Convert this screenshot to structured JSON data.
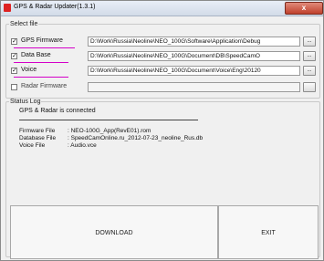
{
  "window": {
    "title": "GPS & Radar Updater(1.3.1)",
    "close_glyph": "x"
  },
  "select_file": {
    "legend": "Select file",
    "rows": [
      {
        "label": "GPS Firmware",
        "checked": true,
        "path": "D:\\Work\\Russia\\Neoline\\NEO_100G\\Software\\Application\\Debug",
        "browse": "..."
      },
      {
        "label": "Data Base",
        "checked": true,
        "path": "D:\\Work\\Russia\\Neoline\\NEO_100G\\Document\\DB\\SpeedCamO",
        "browse": "..."
      },
      {
        "label": "Voice",
        "checked": true,
        "path": "D:\\Work\\Russia\\Neoline\\NEO_100G\\Document\\Voice\\Eng\\20120",
        "browse": "..."
      },
      {
        "label": "Radar Firmware",
        "checked": false,
        "path": "",
        "browse": ""
      }
    ]
  },
  "status_log": {
    "legend": "Status Log",
    "message": "GPS & Radar is connected",
    "files": [
      {
        "label": "Firmware File",
        "value": ": NEO-100G_App(RevE01).rom"
      },
      {
        "label": "Database File",
        "value": ": SpeedCamOnline.ru_2012-07-23_neoline_Rus.db"
      },
      {
        "label": "Voice File",
        "value": ": Audio.vce"
      }
    ]
  },
  "buttons": {
    "download": "DOWNLOAD",
    "exit": "EXIT"
  },
  "colors": {
    "annotation_underline": "#d400c8",
    "close_button": "#c0412c"
  },
  "icons": [
    "app-icon",
    "close-icon"
  ]
}
